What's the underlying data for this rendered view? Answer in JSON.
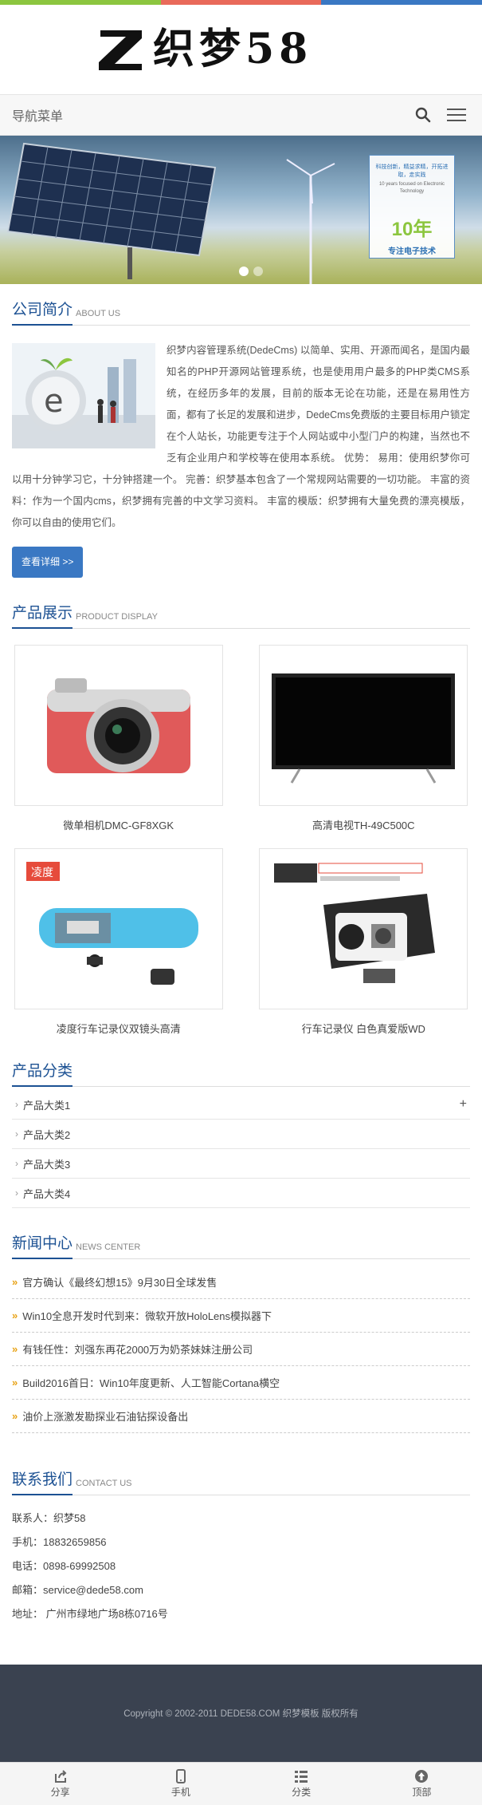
{
  "topbar_colors": [
    "#8cc63f",
    "#e96a5a",
    "#3a78c3"
  ],
  "logo": {
    "text": "织梦58"
  },
  "nav": {
    "title": "导航菜单",
    "search_icon": "search-icon",
    "menu_icon": "menu-icon"
  },
  "banner": {
    "line1": "科技创新，精益求精，开拓进取，走实践",
    "line2": "10 years focused on Electronic Technology",
    "big": "10年",
    "sub": "专注电子技术",
    "slide_count": 2,
    "active_slide": 1
  },
  "about": {
    "title": "公司简介",
    "en": "ABOUT US",
    "text": "织梦内容管理系统(DedeCms) 以简单、实用、开源而闻名，是国内最知名的PHP开源网站管理系统，也是使用用户最多的PHP类CMS系统，在经历多年的发展，目前的版本无论在功能，还是在易用性方面，都有了长足的发展和进步，DedeCms免费版的主要目标用户锁定在个人站长，功能更专注于个人网站或中小型门户的构建，当然也不乏有企业用户和学校等在使用本系统。 优势： 易用：使用织梦你可以用十分钟学习它，十分钟搭建一个。 完善：织梦基本包含了一个常规网站需要的一切功能。 丰富的资料：作为一个国内cms，织梦拥有完善的中文学习资料。 丰富的模版：织梦拥有大量免费的漂亮模版，你可以自由的使用它们。",
    "more": "查看详细 >>"
  },
  "products": {
    "title": "产品展示",
    "en": "PRODUCT DISPLAY",
    "items": [
      {
        "name": "微单相机DMC-GF8XGK"
      },
      {
        "name": "高清电视TH-49C500C"
      },
      {
        "name": "凌度行车记录仪双镜头高清"
      },
      {
        "name": "行车记录仪 白色真爱版WD"
      }
    ]
  },
  "categories": {
    "title": "产品分类",
    "items": [
      {
        "label": "产品大类1",
        "expand": "+"
      },
      {
        "label": "产品大类2",
        "expand": ""
      },
      {
        "label": "产品大类3",
        "expand": ""
      },
      {
        "label": "产品大类4",
        "expand": ""
      }
    ]
  },
  "news": {
    "title": "新闻中心",
    "en": "NEWS CENTER",
    "items": [
      {
        "title": "官方确认《最终幻想15》9月30日全球发售"
      },
      {
        "title": "Win10全息开发时代到来：微软开放HoloLens模拟器下"
      },
      {
        "title": "有钱任性：刘强东再花2000万为奶茶妹妹注册公司"
      },
      {
        "title": "Build2016首日：Win10年度更新、人工智能Cortana横空"
      },
      {
        "title": "油价上涨激发勘探业石油钻探设备出"
      }
    ]
  },
  "contact": {
    "title": "联系我们",
    "en": "CONTACT US",
    "lines": [
      "联系人：织梦58",
      "手机：18832659856",
      "电话：0898-69992508",
      "邮箱：service@dede58.com",
      "地址： 广州市绿地广场8栋0716号"
    ]
  },
  "footer": {
    "copyright": "Copyright © 2002-2011 DEDE58.COM 织梦模板 版权所有"
  },
  "bottom_bar": [
    {
      "label": "分享",
      "icon": "share-icon"
    },
    {
      "label": "手机",
      "icon": "phone-icon"
    },
    {
      "label": "分类",
      "icon": "list-icon"
    },
    {
      "label": "顶部",
      "icon": "arrow-up-icon"
    }
  ]
}
